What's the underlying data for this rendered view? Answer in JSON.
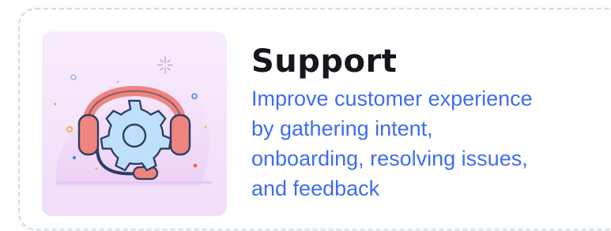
{
  "card": {
    "title": "Support",
    "description_lines": [
      "Improve customer experience",
      "by gathering intent,",
      "onboarding, resolving issues,",
      "and feedback"
    ],
    "illustration": "headset-gear-icon"
  },
  "colors": {
    "title": "#15171c",
    "description": "#3f6df0",
    "card_border": "#d2dbe8",
    "illustration_bg": "#f4e4fb",
    "headset": "#f0847e",
    "gear_fill": "#bfe0fa",
    "gear_stroke": "#2c3e63"
  }
}
